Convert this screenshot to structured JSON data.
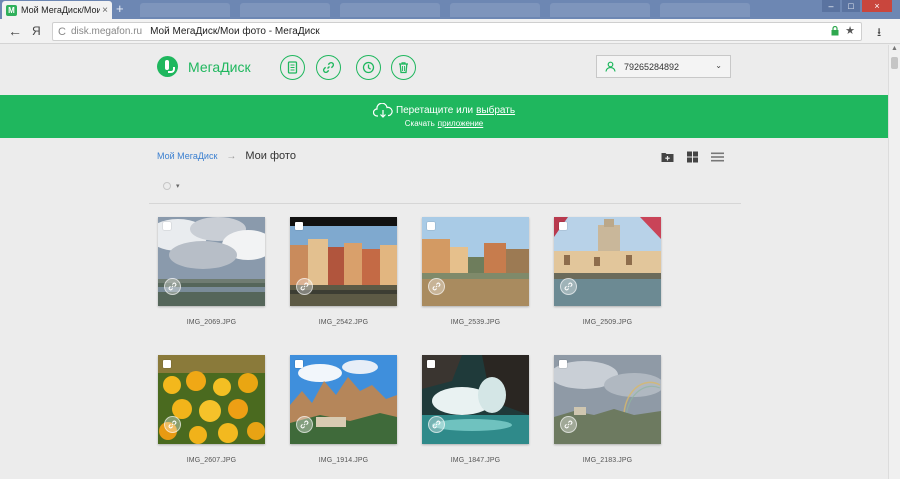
{
  "browser": {
    "tab_favicon": "M",
    "tab_title": "Мой МегаДиск/Мои",
    "tab_close": "×",
    "new_tab": "+",
    "url_host": "disk.megafon.ru",
    "url_page_title": "Мой МегаДиск/Мои фото - МегаДиск",
    "back_glyph": "←",
    "yandex_glyph": "Я",
    "reload_glyph": "C",
    "star_glyph": "★",
    "download_glyph": "⭳",
    "min_glyph": "‒",
    "max_glyph": "□",
    "close_glyph": "×"
  },
  "header": {
    "logo_text": "МегаДиск",
    "tools": [
      {
        "icon": "document-icon"
      },
      {
        "icon": "link-icon"
      },
      {
        "icon": "clock-icon"
      },
      {
        "icon": "trash-icon"
      }
    ],
    "account": {
      "phone": "79265284892",
      "icon": "user-icon",
      "chevron": "⌄"
    }
  },
  "upload": {
    "prefix": "Перетащите или",
    "link": "выбрать",
    "app_prefix": "Скачать",
    "app_link": "приложение"
  },
  "breadcrumb": {
    "root": "Мой МегаДиск",
    "arrow": "→",
    "current": "Мои фото"
  },
  "view_icons": [
    "add-folder-icon",
    "grid-view-icon",
    "list-view-icon"
  ],
  "select_chevron": "▾",
  "photos": [
    {
      "name": "IMG_2069.JPG"
    },
    {
      "name": "IMG_2542.JPG"
    },
    {
      "name": "IMG_2539.JPG"
    },
    {
      "name": "IMG_2509.JPG"
    },
    {
      "name": "IMG_2607.JPG"
    },
    {
      "name": "IMG_1914.JPG"
    },
    {
      "name": "IMG_1847.JPG"
    },
    {
      "name": "IMG_2183.JPG"
    }
  ],
  "colors": {
    "brand_green": "#1fb75e",
    "link_blue": "#3a7fd0",
    "page_bg": "#ececec"
  }
}
